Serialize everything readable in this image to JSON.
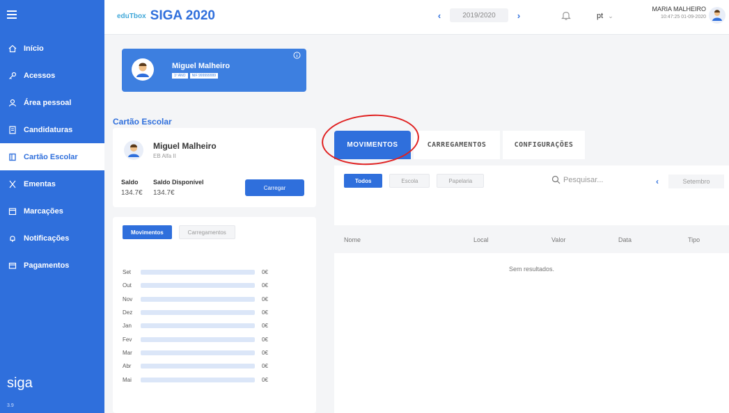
{
  "header": {
    "brand_small": "eduTbox",
    "brand_title": "SIGA 2020",
    "year": "2019/2020",
    "lang": "pt",
    "user_name": "MARIA MALHEIRO",
    "timestamp": "10:47:25 01-09-2020"
  },
  "sidebar": {
    "items": [
      {
        "label": "Início",
        "icon": "home-icon"
      },
      {
        "label": "Acessos",
        "icon": "key-icon"
      },
      {
        "label": "Área pessoal",
        "icon": "user-icon"
      },
      {
        "label": "Candidaturas",
        "icon": "document-icon"
      },
      {
        "label": "Cartão Escolar",
        "icon": "card-icon"
      },
      {
        "label": "Ementas",
        "icon": "cutlery-icon"
      },
      {
        "label": "Marcações",
        "icon": "calendar-icon"
      },
      {
        "label": "Notificações",
        "icon": "bell-icon"
      },
      {
        "label": "Pagamentos",
        "icon": "wallet-icon"
      }
    ],
    "active_index": 4,
    "logo": "siga",
    "version": "3.9"
  },
  "profile": {
    "name": "Miguel Malheiro",
    "tag1": "1º ANO",
    "tag2": "NIF 999999999"
  },
  "school_card": {
    "section_title": "Cartão Escolar",
    "name": "Miguel Malheiro",
    "school": "EB Alfa II",
    "saldo_label": "Saldo",
    "saldo_value": "134.7€",
    "disponivel_label": "Saldo Disponível",
    "disponivel_value": "134.7€",
    "button": "Carregar"
  },
  "side_movements": {
    "tab_on": "Movimentos",
    "tab_off": "Carregamentos",
    "months": [
      {
        "m": "Set",
        "v": "0€"
      },
      {
        "m": "Out",
        "v": "0€"
      },
      {
        "m": "Nov",
        "v": "0€"
      },
      {
        "m": "Dez",
        "v": "0€"
      },
      {
        "m": "Jan",
        "v": "0€"
      },
      {
        "m": "Fev",
        "v": "0€"
      },
      {
        "m": "Mar",
        "v": "0€"
      },
      {
        "m": "Abr",
        "v": "0€"
      },
      {
        "m": "Mai",
        "v": "0€"
      }
    ]
  },
  "tabs": [
    "MOVIMENTOS",
    "CARREGAMENTOS",
    "CONFIGURAÇÕES"
  ],
  "main": {
    "filters": [
      "Todos",
      "Escola",
      "Papelaria"
    ],
    "search_placeholder": "Pesquisar...",
    "month": "Setembro",
    "columns": [
      "Nome",
      "Local",
      "Valor",
      "Data",
      "Tipo"
    ],
    "empty": "Sem resultados."
  },
  "colors": {
    "accent": "#2f6fdc",
    "highlight_circle": "#e02020"
  }
}
